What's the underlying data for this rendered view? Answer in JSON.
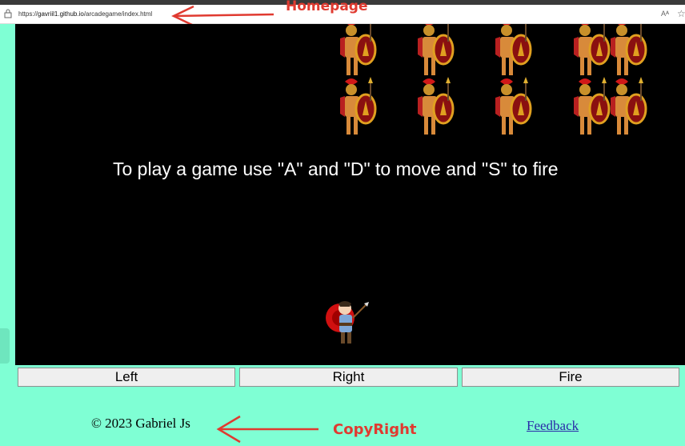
{
  "browser": {
    "url_prefix": "https://",
    "url_domain": "gavriil1.github.io",
    "url_path": "/arcadegame/index.html",
    "reader_icon": "Aᴬ",
    "favorite_icon": "☆"
  },
  "annotations": {
    "homepage": "Homepage",
    "copyright": "CopyRight",
    "color": "#e03a30"
  },
  "game": {
    "instructions": "To play a game use \"A\" and \"D\" to move and \"S\" to fire",
    "background": "#000000",
    "enemy_icon": "spartan-warrior-icon",
    "player_icon": "archer-icon"
  },
  "controls": {
    "left_label": "Left",
    "right_label": "Right",
    "fire_label": "Fire"
  },
  "footer": {
    "copyright": "© 2023 Gabriel Js",
    "feedback_label": "Feedback"
  },
  "colors": {
    "page_background": "#7fffd4",
    "link": "#2a2aa8"
  }
}
